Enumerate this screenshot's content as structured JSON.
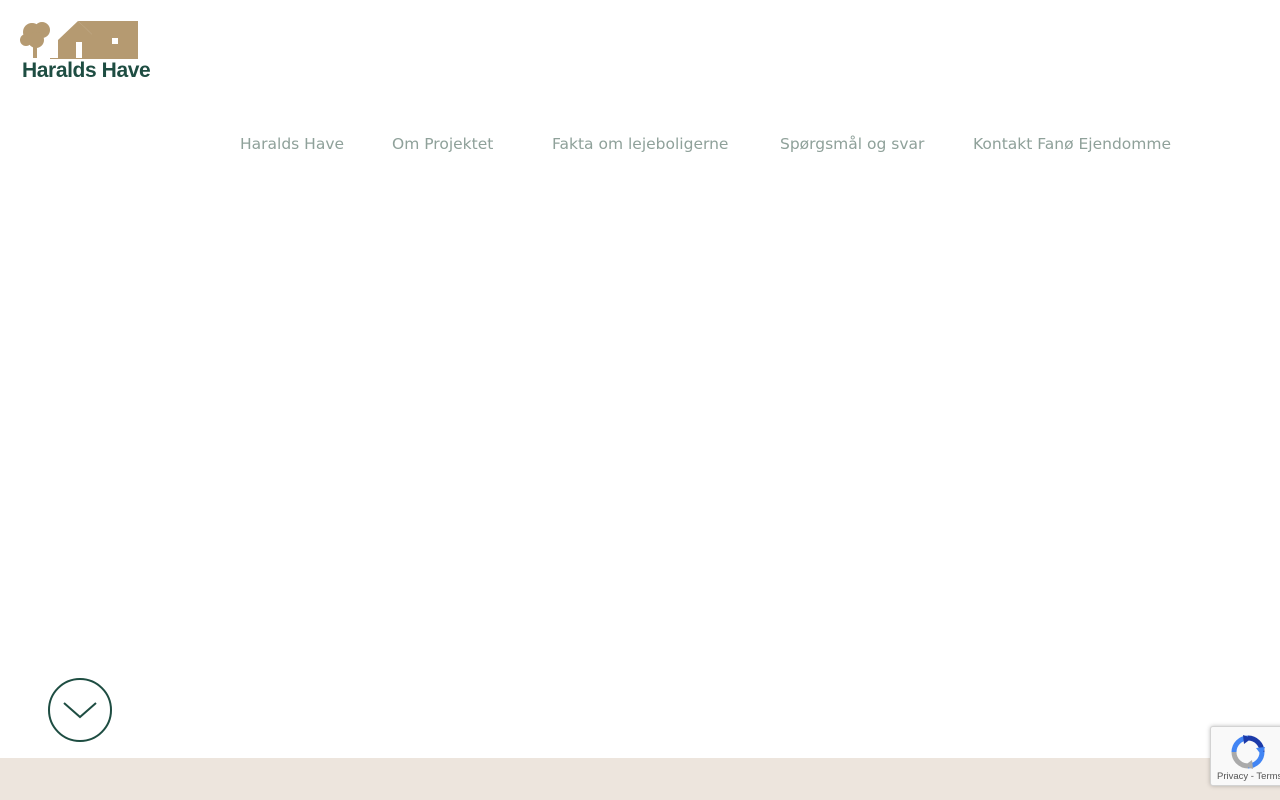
{
  "brand": {
    "name": "Haralds Have",
    "primary_color": "#1e4d42",
    "accent_color": "#b59a71",
    "nav_color": "#8fa19a",
    "footer_bg": "#ede5dd"
  },
  "nav": {
    "items": [
      {
        "label": "Haralds Have"
      },
      {
        "label": "Om Projektet"
      },
      {
        "label": "Fakta om lejeboligerne"
      },
      {
        "label": "Spørgsmål og svar"
      },
      {
        "label": "Kontakt Fanø Ejendomme"
      }
    ]
  },
  "scroll_down": {
    "icon": "chevron-down-icon"
  },
  "recaptcha": {
    "links": "Privacy - Terms",
    "icon": "recaptcha-icon"
  }
}
